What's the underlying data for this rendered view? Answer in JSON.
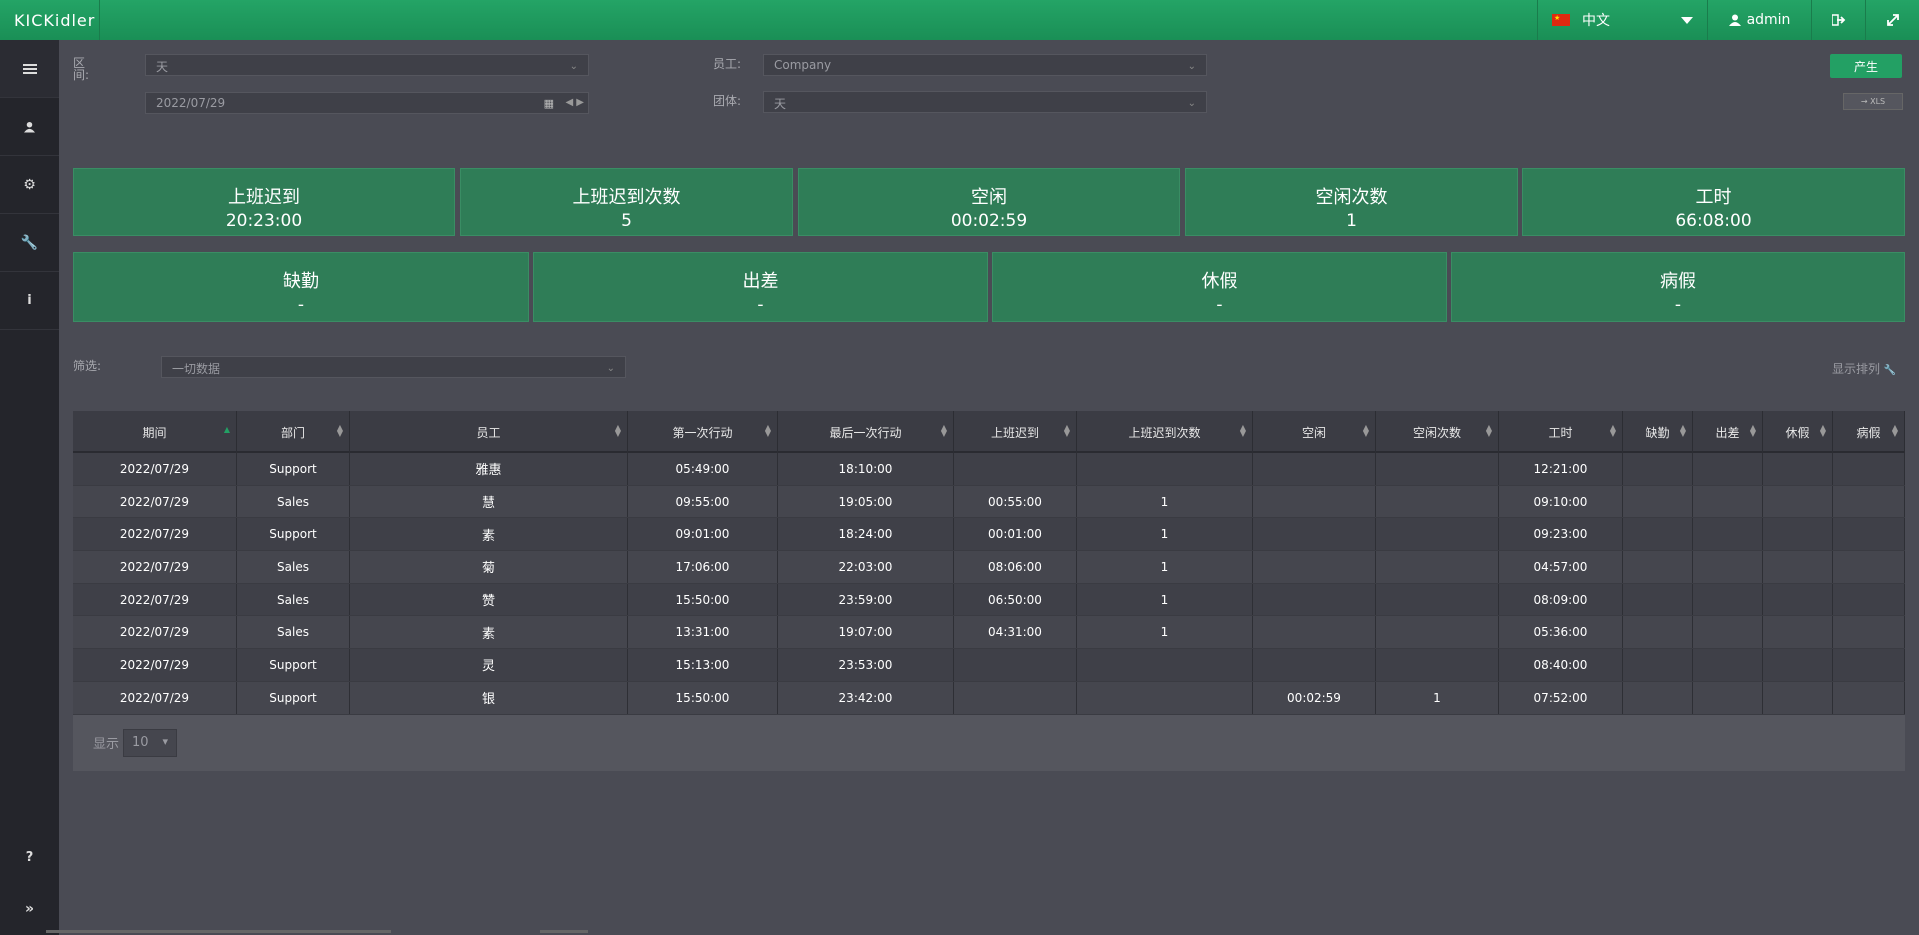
{
  "header": {
    "logo": "KICKidler",
    "language": "中文",
    "user": "admin"
  },
  "filters": {
    "period_label": "区间:",
    "period_value": "天",
    "date_value": "2022/07/29",
    "employee_label": "员工:",
    "employee_value": "Company",
    "group_label": "团体:",
    "group_value": "天",
    "generate_label": "产生",
    "xls_label": "→ XLS",
    "data_filter_label": "筛选:",
    "data_filter_value": "一切数据",
    "show_columns_label": "显示排列"
  },
  "stats_row1": [
    {
      "title": "上班迟到",
      "value": "20:23:00"
    },
    {
      "title": "上班迟到次数",
      "value": "5"
    },
    {
      "title": "空闲",
      "value": "00:02:59"
    },
    {
      "title": "空闲次数",
      "value": "1"
    },
    {
      "title": "工时",
      "value": "66:08:00"
    }
  ],
  "stats_row2": [
    {
      "title": "缺勤",
      "value": "-"
    },
    {
      "title": "出差",
      "value": "-"
    },
    {
      "title": "休假",
      "value": "-"
    },
    {
      "title": "病假",
      "value": "-"
    }
  ],
  "table": {
    "columns": [
      "期间",
      "部门",
      "员工",
      "第一次行动",
      "最后一次行动",
      "上班迟到",
      "上班迟到次数",
      "空闲",
      "空闲次数",
      "工时",
      "缺勤",
      "出差",
      "休假",
      "病假"
    ],
    "rows": [
      [
        "2022/07/29",
        "Support",
        "雅惠",
        "05:49:00",
        "18:10:00",
        "",
        "",
        "",
        "",
        "12:21:00",
        "",
        "",
        "",
        ""
      ],
      [
        "2022/07/29",
        "Sales",
        "慧",
        "09:55:00",
        "19:05:00",
        "00:55:00",
        "1",
        "",
        "",
        "09:10:00",
        "",
        "",
        "",
        ""
      ],
      [
        "2022/07/29",
        "Support",
        "素",
        "09:01:00",
        "18:24:00",
        "00:01:00",
        "1",
        "",
        "",
        "09:23:00",
        "",
        "",
        "",
        ""
      ],
      [
        "2022/07/29",
        "Sales",
        "菊",
        "17:06:00",
        "22:03:00",
        "08:06:00",
        "1",
        "",
        "",
        "04:57:00",
        "",
        "",
        "",
        ""
      ],
      [
        "2022/07/29",
        "Sales",
        "赞",
        "15:50:00",
        "23:59:00",
        "06:50:00",
        "1",
        "",
        "",
        "08:09:00",
        "",
        "",
        "",
        ""
      ],
      [
        "2022/07/29",
        "Sales",
        "素",
        "13:31:00",
        "19:07:00",
        "04:31:00",
        "1",
        "",
        "",
        "05:36:00",
        "",
        "",
        "",
        ""
      ],
      [
        "2022/07/29",
        "Support",
        "灵",
        "15:13:00",
        "23:53:00",
        "",
        "",
        "",
        "",
        "08:40:00",
        "",
        "",
        "",
        ""
      ],
      [
        "2022/07/29",
        "Support",
        "银",
        "15:50:00",
        "23:42:00",
        "",
        "",
        "00:02:59",
        "1",
        "07:52:00",
        "",
        "",
        "",
        ""
      ]
    ],
    "show_label": "显示",
    "page_size": "10"
  }
}
